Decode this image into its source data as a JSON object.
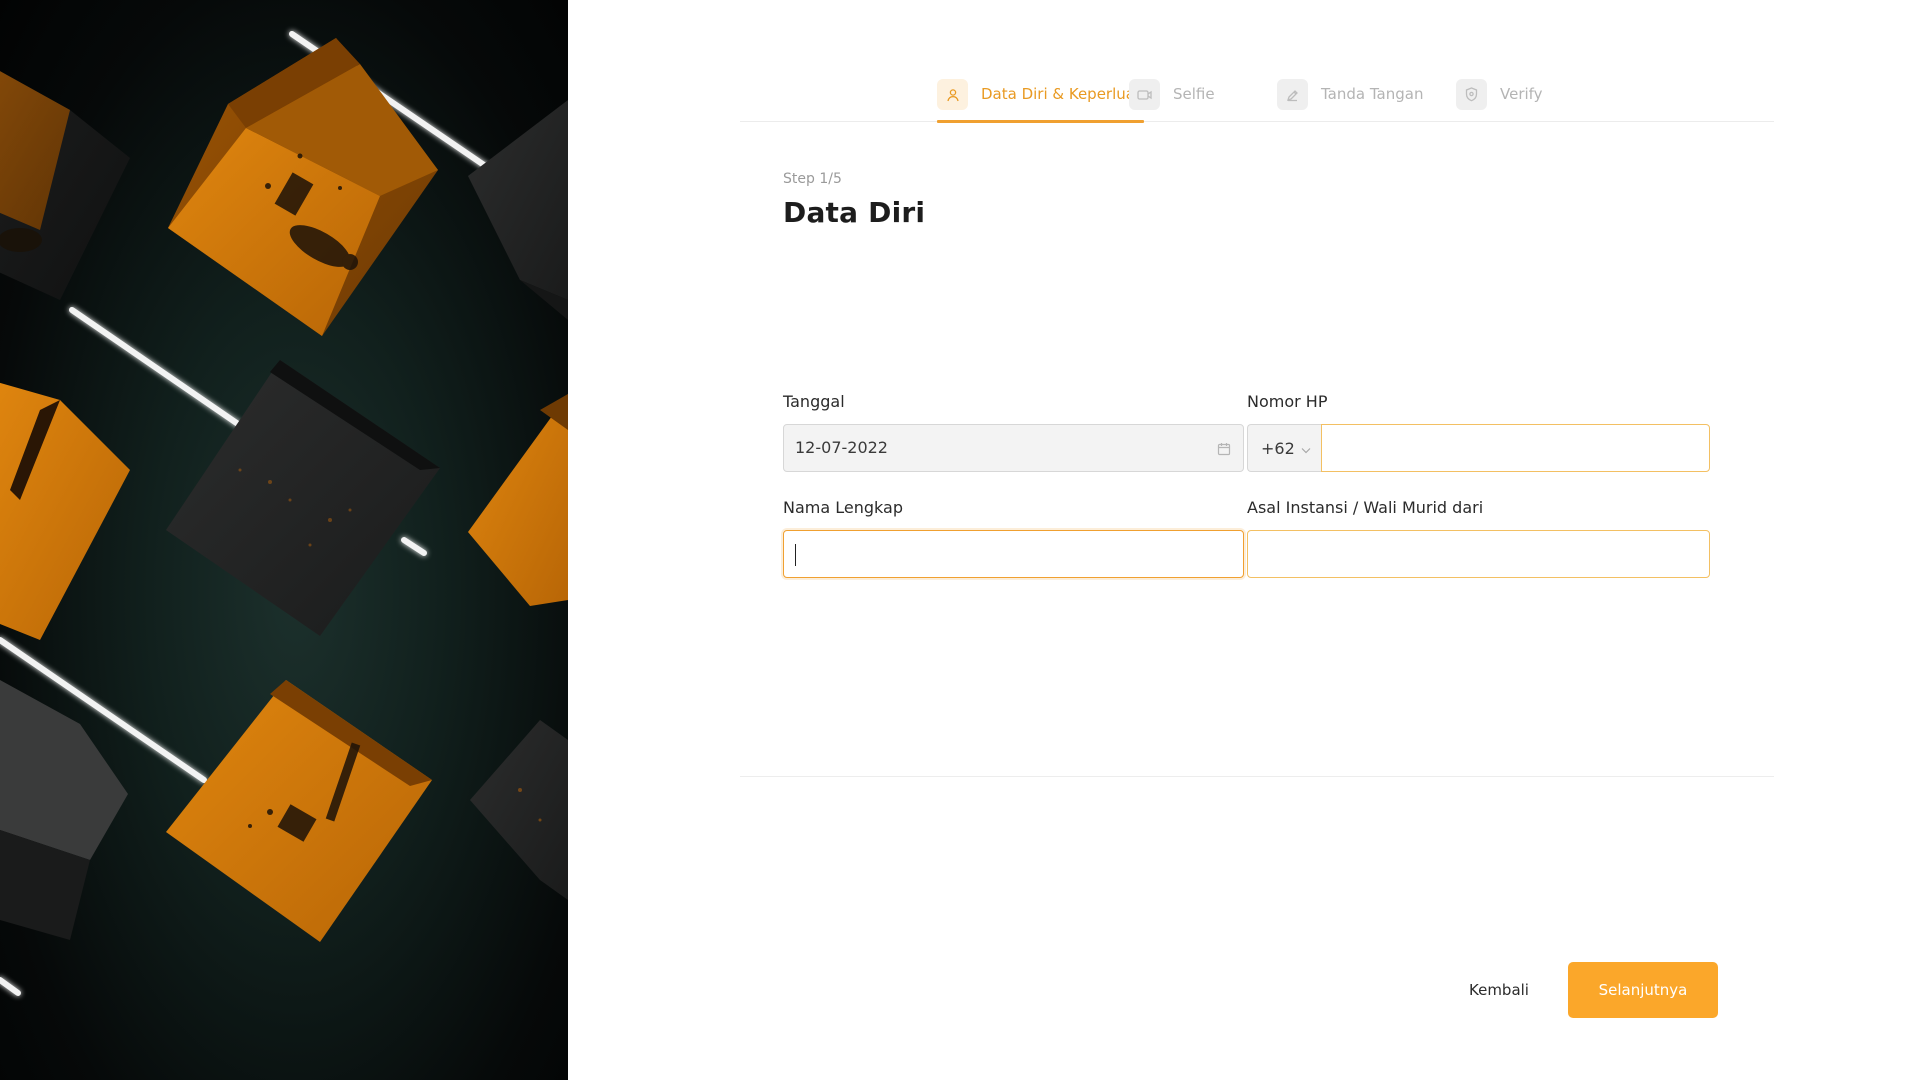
{
  "stepper": {
    "steps": [
      {
        "label": "Data Diri & Keperluan",
        "icon": "user-icon",
        "active": true
      },
      {
        "label": "Selfie",
        "icon": "camera-icon",
        "active": false
      },
      {
        "label": "Tanda Tangan",
        "icon": "pen-icon",
        "active": false
      },
      {
        "label": "Verify",
        "icon": "shield-icon",
        "active": false
      }
    ]
  },
  "header": {
    "step_counter": "Step 1/5",
    "title": "Data Diri"
  },
  "form": {
    "tanggal": {
      "label": "Tanggal",
      "value": "12-07-2022",
      "icon": "calendar-icon"
    },
    "nomor_hp": {
      "label": "Nomor HP",
      "country_code": "+62",
      "value": ""
    },
    "nama_lengkap": {
      "label": "Nama Lengkap",
      "value": ""
    },
    "asal_instansi": {
      "label": "Asal Instansi / Wali Murid dari",
      "value": ""
    }
  },
  "actions": {
    "back_label": "Kembali",
    "next_label": "Selanjutnya"
  },
  "colors": {
    "accent": "#fba72a",
    "accent_text": "#e99a22",
    "inactive_text": "#b4b4b4"
  }
}
